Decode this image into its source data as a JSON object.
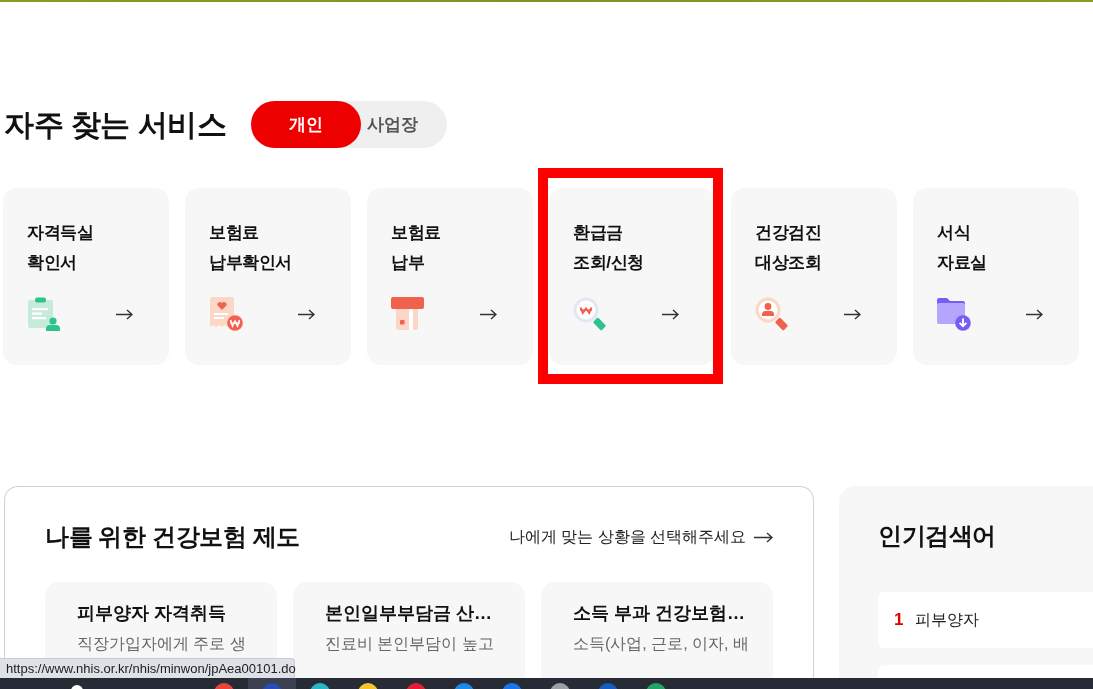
{
  "top_services": {
    "title": "자주 찾는 서비스",
    "tabs": [
      {
        "label": "개인",
        "selected": true
      },
      {
        "label": "사업장",
        "selected": false
      }
    ],
    "cards": [
      {
        "title_lines": [
          "자격득실",
          "확인서"
        ],
        "kind": "clipboard",
        "highlighted": false
      },
      {
        "title_lines": [
          "보험료",
          "납부확인서"
        ],
        "kind": "receipt",
        "highlighted": false
      },
      {
        "title_lines": [
          "보험료",
          "납부"
        ],
        "kind": "card",
        "highlighted": false
      },
      {
        "title_lines": [
          "환급금",
          "조회/신청"
        ],
        "kind": "magnifier-won",
        "highlighted": true
      },
      {
        "title_lines": [
          "건강검진",
          "대상조회"
        ],
        "kind": "magnifier-person",
        "highlighted": false
      },
      {
        "title_lines": [
          "서식",
          "자료실"
        ],
        "kind": "folder",
        "highlighted": false
      }
    ]
  },
  "insurance": {
    "title": "나를 위한 건강보험 제도",
    "link": "나에게 맞는 상황을 선택해주세요",
    "cards": [
      {
        "title": "피부양자 자격취득",
        "description": "직장가입자에게 주로 생"
      },
      {
        "title": "본인일부부담금 산…",
        "description": "진료비 본인부담이 높고"
      },
      {
        "title": "소득 부과 건강보험…",
        "description": "소득(사업, 근로, 이자, 배"
      }
    ]
  },
  "popular_searches": {
    "title": "인기검색어",
    "items": [
      {
        "rank": "1",
        "term": "피부양자"
      }
    ]
  },
  "status_url": "https://www.nhis.or.kr/nhis/minwon/jpAea00101.do",
  "taskbar": {
    "apps": [
      {
        "kind": "start",
        "color": "#ffffff",
        "selected": false
      },
      {
        "kind": "app",
        "color": "#e8453c",
        "selected": false
      },
      {
        "kind": "app",
        "color": "#2b4bb5",
        "selected": true
      },
      {
        "kind": "app",
        "color": "#29b6c8",
        "selected": false
      },
      {
        "kind": "app",
        "color": "#f4c430",
        "selected": false
      },
      {
        "kind": "app",
        "color": "#e02030",
        "selected": false
      },
      {
        "kind": "app",
        "color": "#1e88e5",
        "selected": false
      },
      {
        "kind": "app",
        "color": "#1a73e8",
        "selected": false
      },
      {
        "kind": "app",
        "color": "#9aa0a6",
        "selected": false
      },
      {
        "kind": "app",
        "color": "#185abd",
        "selected": false
      },
      {
        "kind": "app",
        "color": "#21a366",
        "selected": false
      }
    ]
  }
}
